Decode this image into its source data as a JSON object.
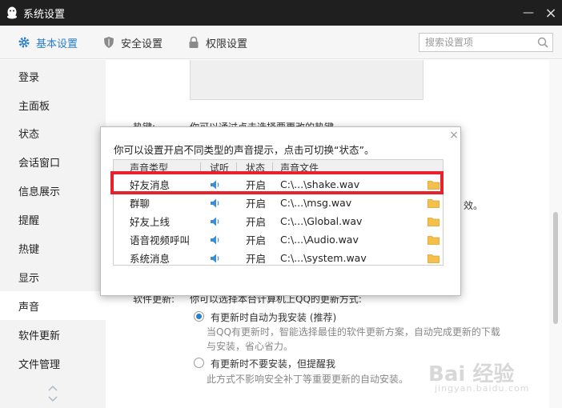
{
  "window": {
    "title": "系统设置",
    "controls": {
      "minimize": "—",
      "close": "×"
    }
  },
  "topnav": {
    "tabs": [
      {
        "label": "基本设置",
        "icon": "gear-icon",
        "active": true
      },
      {
        "label": "安全设置",
        "icon": "shield-icon",
        "active": false
      },
      {
        "label": "权限设置",
        "icon": "lock-icon",
        "active": false
      }
    ],
    "search": {
      "placeholder": "搜索设置项",
      "value": ""
    }
  },
  "sidebar": {
    "items": [
      {
        "label": "登录",
        "active": false
      },
      {
        "label": "主面板",
        "active": false
      },
      {
        "label": "状态",
        "active": false
      },
      {
        "label": "会话窗口",
        "active": false
      },
      {
        "label": "信息展示",
        "active": false
      },
      {
        "label": "提醒",
        "active": false
      },
      {
        "label": "热键",
        "active": false
      },
      {
        "label": "显示",
        "active": false
      },
      {
        "label": "声音",
        "active": true
      },
      {
        "label": "软件更新",
        "active": false
      },
      {
        "label": "文件管理",
        "active": false
      }
    ]
  },
  "content": {
    "hotkey_label": "热键:",
    "hotkey_desc": "你可以通过点击选择要更改的热键",
    "partial_effect": "效。",
    "update_label": "软件更新:",
    "update_desc": "你可以选择本台计算机上QQ的更新方式:",
    "option_auto": {
      "label": "有更新时自动为我安装 (推荐)",
      "checked": true,
      "desc_line1": "当QQ有更新时，智能选择最佳的软件更新方案，自动完成更新的下载",
      "desc_line2": "与安装，省心省力。"
    },
    "option_manual": {
      "label": "有更新时不要安装，但提醒我",
      "checked": false,
      "desc": "此方式不影响安全补丁等重要更新的自动安装。"
    }
  },
  "popup": {
    "close": "×",
    "description": "你可以设置开启不同类型的声音提示，点击可切换“状态”。",
    "columns": [
      "声音类型",
      "试听",
      "状态",
      "声音文件"
    ],
    "rows": [
      {
        "type": "好友消息",
        "state": "开启",
        "file": "C:\\...\\shake.wav",
        "highlighted": true
      },
      {
        "type": "群聊",
        "state": "开启",
        "file": "C:\\...\\msg.wav",
        "highlighted": false
      },
      {
        "type": "好友上线",
        "state": "开启",
        "file": "C:\\...\\Global.wav",
        "highlighted": false
      },
      {
        "type": "语音视频呼叫",
        "state": "开启",
        "file": "C:\\...\\Audio.wav",
        "highlighted": false
      },
      {
        "type": "系统消息",
        "state": "开启",
        "file": "C:\\...\\system.wav",
        "highlighted": false
      }
    ]
  },
  "watermark": {
    "main": "Bai 经验",
    "sub": "jingyan.baidu.com"
  },
  "colors": {
    "titlebar": "#1f1f1f",
    "accent": "#2a7fc9",
    "highlight": "#e8222c",
    "folder": "#f5c04a",
    "speaker": "#3b8ed6"
  }
}
